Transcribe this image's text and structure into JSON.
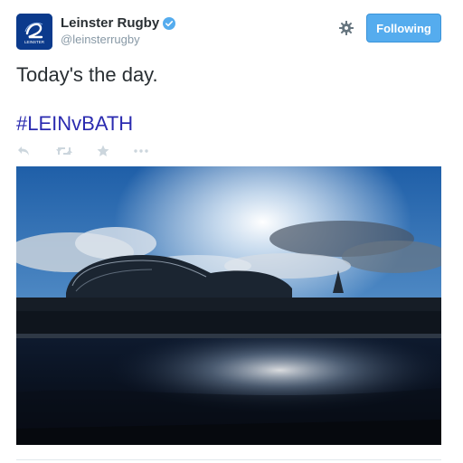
{
  "user": {
    "display_name": "Leinster Rugby",
    "handle": "@leinsterrugby",
    "verified": true,
    "avatar_icon": "leinster-logo-icon",
    "avatar_text": "LEINSTER"
  },
  "header": {
    "settings_icon": "gear-icon",
    "follow_label": "Following"
  },
  "tweet": {
    "text": "Today's the day.",
    "hashtag": "#LEINvBATH"
  },
  "actions": {
    "reply_icon": "reply-icon",
    "retweet_icon": "retweet-icon",
    "favorite_icon": "star-icon",
    "more_icon": "more-dots-icon"
  },
  "colors": {
    "follow_button": "#55acee",
    "hashtag": "#2b2bb0",
    "verified": "#55acee",
    "action_icons": "#ccd6dd"
  }
}
